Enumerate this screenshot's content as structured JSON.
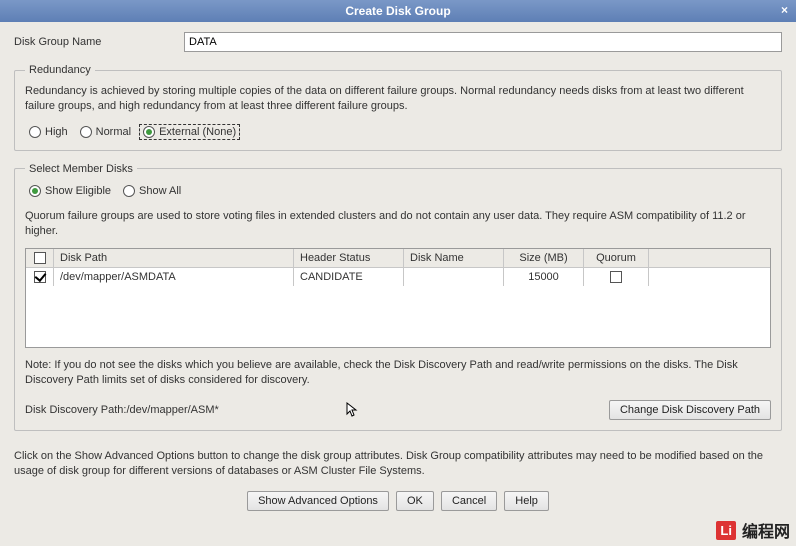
{
  "window": {
    "title": "Create Disk Group"
  },
  "name_field": {
    "label": "Disk Group Name",
    "value": "DATA"
  },
  "redundancy": {
    "legend": "Redundancy",
    "description": "Redundancy is achieved by storing multiple copies of the data on different failure groups. Normal redundancy needs disks from at least two different failure groups, and high redundancy from at least three different failure groups.",
    "options": {
      "high": "High",
      "normal": "Normal",
      "external": "External (None)"
    },
    "selected": "external"
  },
  "member_disks": {
    "legend": "Select Member Disks",
    "filter": {
      "eligible": "Show Eligible",
      "all": "Show All",
      "selected": "eligible"
    },
    "quorum_note": "Quorum failure groups are used to store voting files in extended clusters and do not contain any user data. They require ASM compatibility of 11.2 or higher.",
    "columns": {
      "path": "Disk Path",
      "header": "Header Status",
      "name": "Disk Name",
      "size": "Size (MB)",
      "quorum": "Quorum"
    },
    "rows": [
      {
        "checked": true,
        "path": "/dev/mapper/ASMDATA",
        "header": "CANDIDATE",
        "name": "",
        "size": "15000",
        "quorum": false
      }
    ],
    "note": "Note: If you do not see the disks which you believe are available, check the Disk Discovery Path and read/write permissions on the disks. The Disk Discovery Path limits set of disks considered for discovery.",
    "discovery_path_label": "Disk Discovery Path:",
    "discovery_path_value": "/dev/mapper/ASM*",
    "change_path_btn": "Change Disk Discovery Path"
  },
  "outer_note": "Click on the Show Advanced Options button to change the disk group attributes. Disk Group compatibility attributes may need to be modified based on the usage of disk group for different versions of databases or ASM Cluster File Systems.",
  "buttons": {
    "advanced": "Show Advanced Options",
    "ok": "OK",
    "cancel": "Cancel",
    "help": "Help"
  },
  "watermark": {
    "logo": "Li",
    "text": "编程网"
  }
}
